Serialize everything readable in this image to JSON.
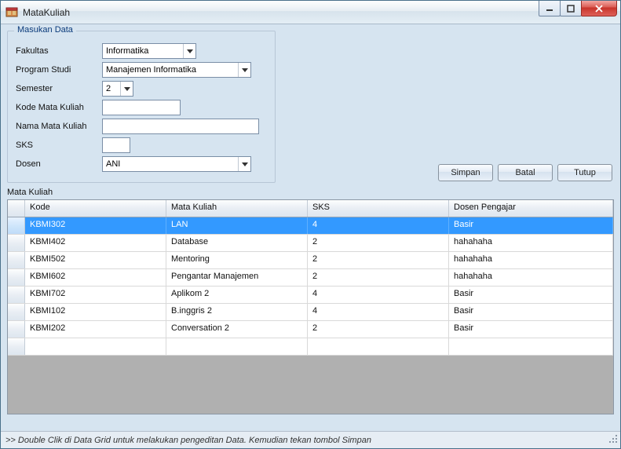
{
  "window": {
    "title": "MataKuliah"
  },
  "group": {
    "legend": "Masukan Data",
    "labels": {
      "fakultas": "Fakultas",
      "prodi": "Program Studi",
      "semester": "Semester",
      "kode": "Kode Mata Kuliah",
      "nama": "Nama Mata Kuliah",
      "sks": "SKS",
      "dosen": "Dosen"
    },
    "values": {
      "fakultas": "Informatika",
      "prodi": "Manajemen Informatika",
      "semester": "2",
      "kode": "",
      "nama": "",
      "sks": "",
      "dosen": "ANI"
    }
  },
  "buttons": {
    "save": "Simpan",
    "cancel": "Batal",
    "close": "Tutup"
  },
  "grid": {
    "title": "Mata Kuliah",
    "headers": {
      "kode": "Kode",
      "mk": "Mata Kuliah",
      "sks": "SKS",
      "dosen": "Dosen Pengajar"
    },
    "rows": [
      {
        "kode": "KBMI302",
        "mk": "LAN",
        "sks": "4",
        "dosen": "Basir",
        "selected": true
      },
      {
        "kode": "KBMI402",
        "mk": "Database",
        "sks": "2",
        "dosen": "hahahaha"
      },
      {
        "kode": "KBMI502",
        "mk": "Mentoring",
        "sks": "2",
        "dosen": "hahahaha"
      },
      {
        "kode": "KBMI602",
        "mk": "Pengantar Manajemen",
        "sks": "2",
        "dosen": "hahahaha"
      },
      {
        "kode": "KBMI702",
        "mk": "Aplikom 2",
        "sks": "4",
        "dosen": "Basir"
      },
      {
        "kode": "KBMI102",
        "mk": "B.inggris 2",
        "sks": "4",
        "dosen": "Basir"
      },
      {
        "kode": "KBMI202",
        "mk": "Conversation 2",
        "sks": "2",
        "dosen": "Basir"
      }
    ]
  },
  "status": ">> Double Clik di Data Grid untuk melakukan pengeditan Data. Kemudian tekan tombol Simpan"
}
